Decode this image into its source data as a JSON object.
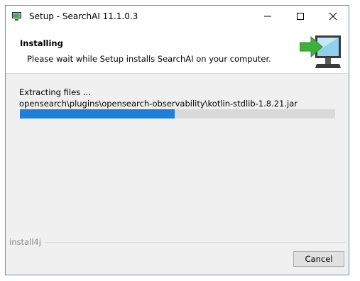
{
  "window": {
    "title": "Setup - SearchAI 11.1.0.3",
    "controls": {
      "minimize_icon": "minimize-icon",
      "maximize_icon": "maximize-icon",
      "close_icon": "close-icon"
    }
  },
  "header": {
    "title": "Installing",
    "subtitle": "Please wait while Setup installs SearchAI on your computer.",
    "icon": "monitor-arrow-icon"
  },
  "progress": {
    "status": "Extracting files ...",
    "current_file": "opensearch\\plugins\\opensearch-observability\\kotlin-stdlib-1.8.21.jar",
    "fraction": 0.49
  },
  "footer": {
    "brand": "install4j",
    "cancel_label": "Cancel"
  },
  "colors": {
    "progress_fill": "#1f7ed8",
    "progress_track": "#d9d9d9",
    "window_border": "#6d8fb5",
    "accent_green": "#3fb03a"
  }
}
